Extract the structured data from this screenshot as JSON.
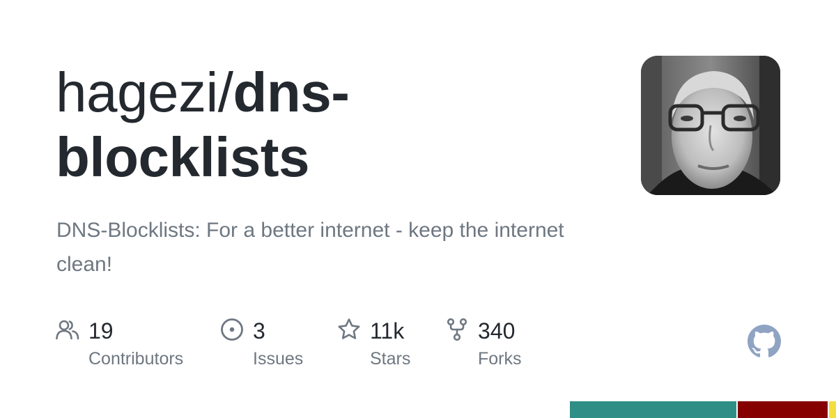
{
  "repo": {
    "owner_prefix": "hagezi/",
    "name": "dns-blocklists",
    "description": "DNS-Blocklists: For a better internet - keep the internet clean!"
  },
  "stats": [
    {
      "icon": "people-icon",
      "value": "19",
      "label": "Contributors"
    },
    {
      "icon": "issue-circle-icon",
      "value": "3",
      "label": "Issues"
    },
    {
      "icon": "star-icon",
      "value": "11k",
      "label": "Stars"
    },
    {
      "icon": "fork-icon",
      "value": "340",
      "label": "Forks"
    }
  ],
  "colors": {
    "title": "#24292f",
    "muted": "#6e7781",
    "icon": "#6e7781",
    "github_logo": "#8fa3c3"
  },
  "language_bar": [
    {
      "color": "#2f8f86",
      "fraction": 0.634
    },
    {
      "color": "#870000",
      "fraction": 0.34
    },
    {
      "color": "#f4de3d",
      "fraction": 0.026
    }
  ]
}
